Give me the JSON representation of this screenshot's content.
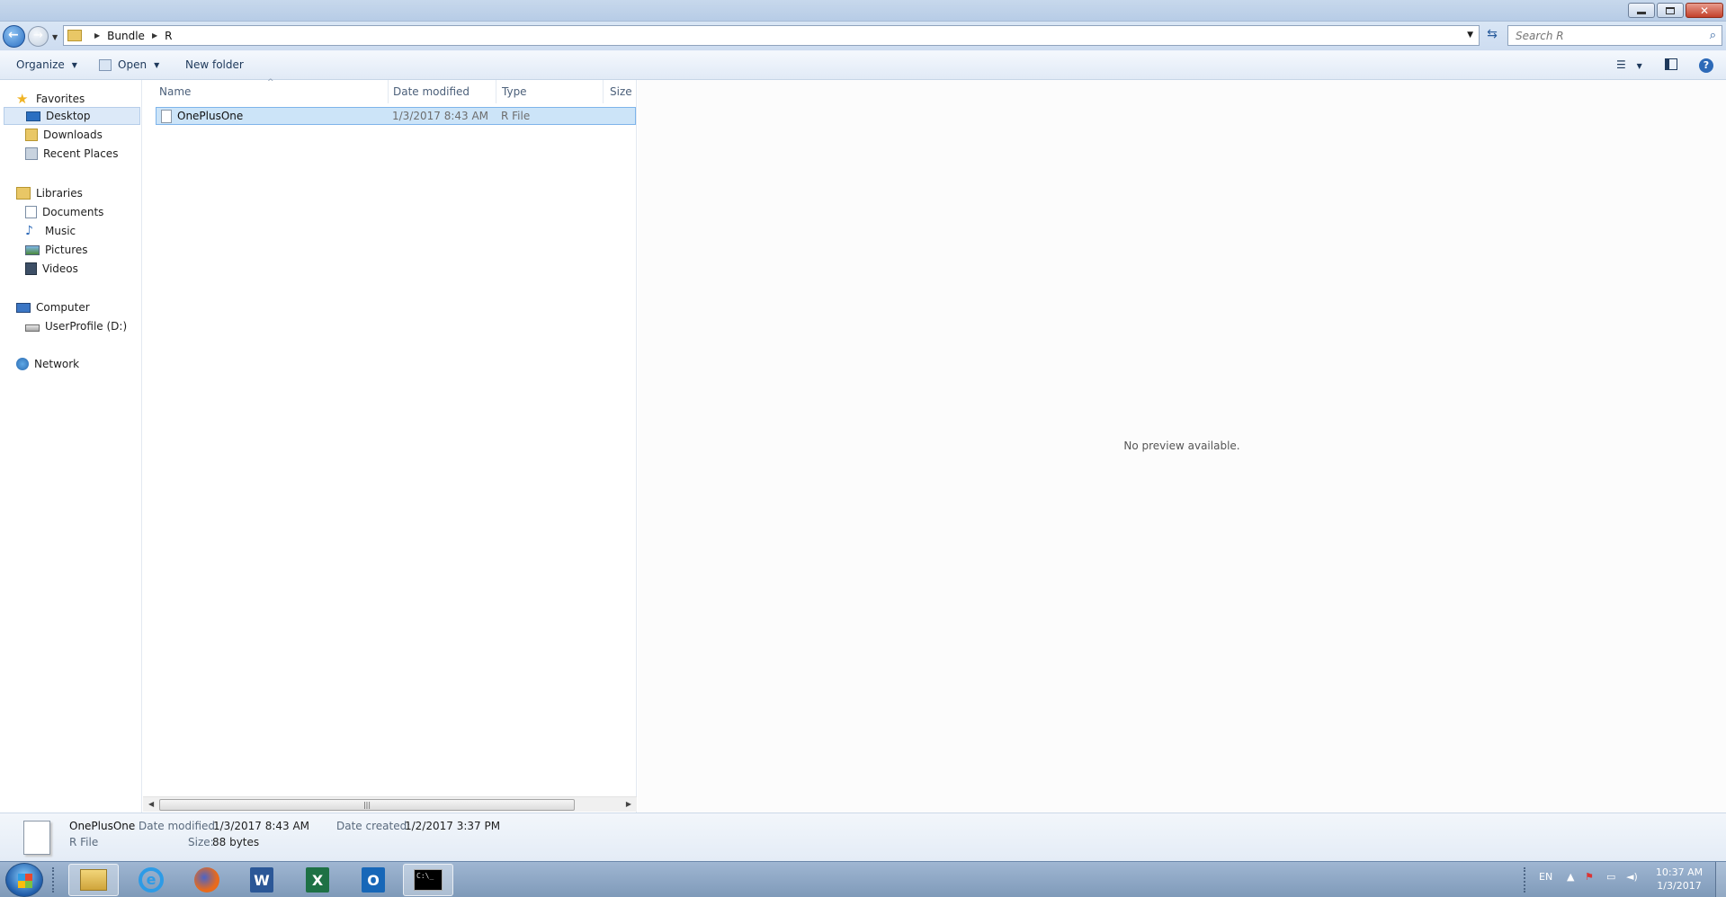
{
  "address": {
    "crumbs": [
      "Bundle",
      "R"
    ]
  },
  "search": {
    "placeholder": "Search R"
  },
  "toolbar": {
    "organize_label": "Organize",
    "open_label": "Open",
    "new_folder_label": "New folder"
  },
  "nav": {
    "favorites": {
      "label": "Favorites",
      "items": [
        {
          "label": "Desktop",
          "icon": "desktop-icon",
          "selected": true
        },
        {
          "label": "Downloads",
          "icon": "downloads-icon"
        },
        {
          "label": "Recent Places",
          "icon": "recent-places-icon"
        }
      ]
    },
    "libraries": {
      "label": "Libraries",
      "items": [
        {
          "label": "Documents",
          "icon": "documents-icon"
        },
        {
          "label": "Music",
          "icon": "music-icon"
        },
        {
          "label": "Pictures",
          "icon": "pictures-icon"
        },
        {
          "label": "Videos",
          "icon": "videos-icon"
        }
      ]
    },
    "computer": {
      "label": "Computer",
      "items": [
        {
          "label": "UserProfile (D:)",
          "icon": "drive-icon"
        }
      ]
    },
    "network": {
      "label": "Network"
    }
  },
  "filelist": {
    "columns": [
      "Name",
      "Date modified",
      "Type",
      "Size"
    ],
    "rows": [
      {
        "name": "OnePlusOne",
        "date_modified": "1/3/2017 8:43 AM",
        "type": "R File",
        "size": "",
        "selected": true
      }
    ]
  },
  "preview": {
    "message": "No preview available."
  },
  "details": {
    "name": "OnePlusOne",
    "type": "R File",
    "date_modified_label": "Date modified:",
    "date_modified": "1/3/2017 8:43 AM",
    "date_created_label": "Date created:",
    "date_created": "1/2/2017 3:37 PM",
    "size_label": "Size:",
    "size": "88 bytes"
  },
  "taskbar": {
    "apps": [
      "windows-explorer-icon",
      "internet-explorer-icon",
      "firefox-icon",
      "word-icon",
      "excel-icon",
      "outlook-icon",
      "command-prompt-icon"
    ],
    "word_letter": "W",
    "excel_letter": "X",
    "outlook_letter": "O",
    "ie_letter": "e",
    "cmd_text": "C:\\_",
    "language": "EN",
    "time": "10:37 AM",
    "date": "1/3/2017"
  },
  "colors": {
    "selection": "#cce4f8",
    "selection_border": "#7eb4ea",
    "taskbar": "#8ea8c6",
    "titlebar": "#c1d4ea"
  }
}
